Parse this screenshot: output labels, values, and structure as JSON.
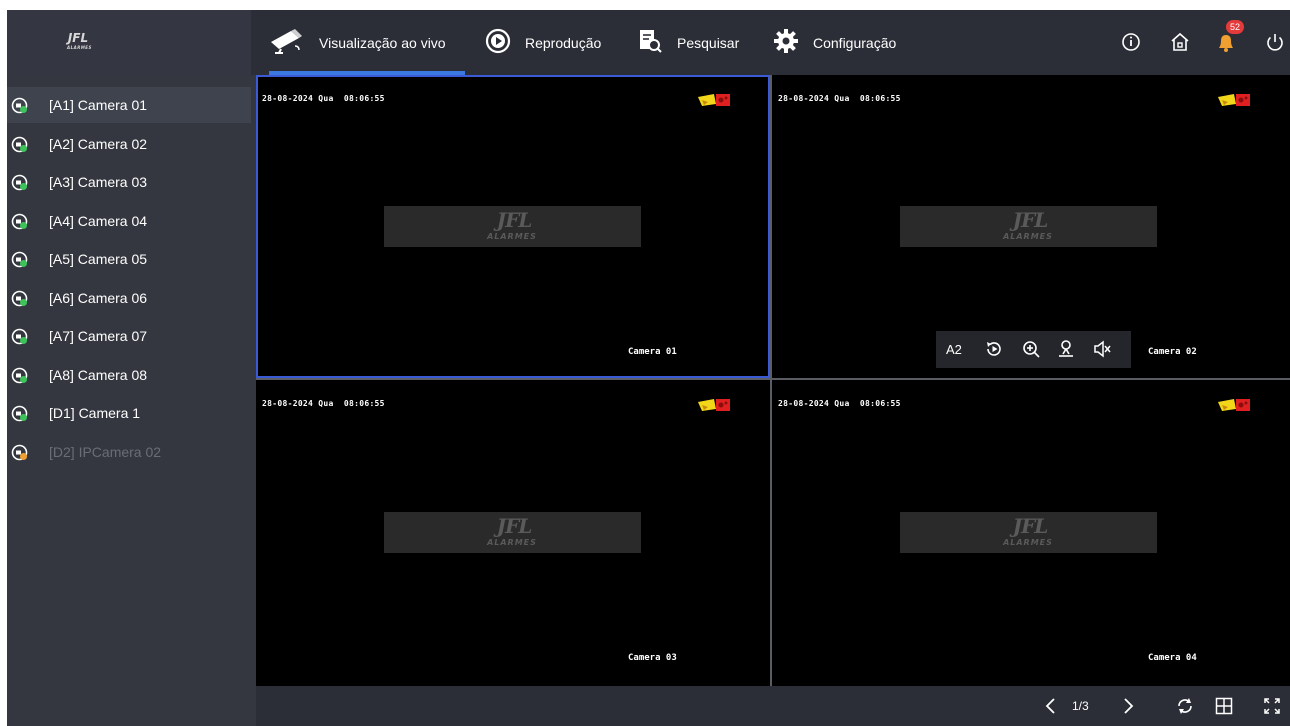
{
  "header": {
    "logo_text": "JFL",
    "logo_subtext": "ALARMES",
    "tabs": [
      {
        "label": "Visualização ao vivo",
        "icon": "camera-icon",
        "active": true
      },
      {
        "label": "Reprodução",
        "icon": "playback-icon",
        "active": false
      },
      {
        "label": "Pesquisar",
        "icon": "search-file-icon",
        "active": false
      },
      {
        "label": "Configuração",
        "icon": "gear-icon",
        "active": false
      }
    ],
    "right_icons": [
      "info-icon",
      "home-icon",
      "bell-icon",
      "power-icon"
    ],
    "notification_count": "52"
  },
  "sidebar": {
    "cameras": [
      {
        "label": "[A1] Camera 01",
        "status": "online"
      },
      {
        "label": "[A2] Camera 02",
        "status": "online"
      },
      {
        "label": "[A3] Camera 03",
        "status": "online"
      },
      {
        "label": "[A4] Camera 04",
        "status": "online"
      },
      {
        "label": "[A5] Camera 05",
        "status": "online"
      },
      {
        "label": "[A6] Camera 06",
        "status": "online"
      },
      {
        "label": "[A7] Camera 07",
        "status": "online"
      },
      {
        "label": "[A8] Camera 08",
        "status": "online"
      },
      {
        "label": "[D1] Camera 1",
        "status": "online"
      },
      {
        "label": "[D2] IPCamera 02",
        "status": "offline"
      }
    ]
  },
  "tiles": [
    {
      "timestamp": "28-08-2024 Qua  08:06:55",
      "name": "Camera 01",
      "watermark": "JFL",
      "watermark_sub": "ALARMES"
    },
    {
      "timestamp": "28-08-2024 Qua  08:06:55",
      "name": "Camera 02",
      "watermark": "JFL",
      "watermark_sub": "ALARMES"
    },
    {
      "timestamp": "28-08-2024 Qua  08:06:55",
      "name": "Camera 03",
      "watermark": "JFL",
      "watermark_sub": "ALARMES"
    },
    {
      "timestamp": "28-08-2024 Qua  08:06:55",
      "name": "Camera 04",
      "watermark": "JFL",
      "watermark_sub": "ALARMES"
    }
  ],
  "tile_toolbar": {
    "channel_label": "A2",
    "icons": [
      "instant-playback-icon",
      "digital-zoom-icon",
      "ptz-icon",
      "audio-mute-icon"
    ]
  },
  "footer": {
    "page_indicator": "1/3",
    "icons": [
      "prev-page-icon",
      "next-page-icon",
      "refresh-icon",
      "layout-grid-icon",
      "fullscreen-icon"
    ]
  },
  "colors": {
    "accent": "#3b79e0",
    "selected_border": "#3b5ad6",
    "badge": "#e43a3a",
    "online_icon": "#3cc35a",
    "offline_icon": "#f0a030"
  }
}
